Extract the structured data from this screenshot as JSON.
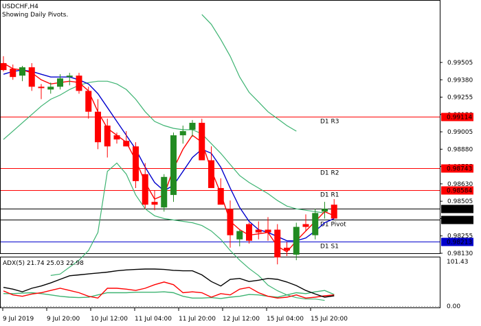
{
  "header": {
    "symbol": "USDCHF,H4",
    "subtitle": "Showing Daily Pivots."
  },
  "indicator": {
    "label": "ADX(5) 21.74 25.03 22.98",
    "top": "101.43",
    "bottom": "0.00"
  },
  "colors": {
    "bull": "#228b22",
    "bear": "#ff0000",
    "ma_fast": "#ff0000",
    "ma_slow": "#0000cd",
    "bands": "#3cb371",
    "adx": "#000000",
    "plus_di": "#ff0000",
    "minus_di": "#3cb371",
    "pivot_red": "#ff0000",
    "pivot_black": "#000000",
    "pivot_blue": "#0000cd"
  },
  "chart_data": {
    "type": "candlestick",
    "title": "USDCHF,H4",
    "ylim": [
      0.9813,
      0.9995
    ],
    "yticks": [
      "0.99505",
      "0.99380",
      "0.99255",
      "0.99130",
      "0.99005",
      "0.98880",
      "0.98755",
      "0.98630",
      "0.98505",
      "0.98380",
      "0.98255",
      "0.98130"
    ],
    "xticks": [
      "9 Jul 2019",
      "9 Jul 20:00",
      "10 Jul 12:00",
      "11 Jul 04:00",
      "11 Jul 20:00",
      "12 Jul 12:00",
      "15 Jul 04:00",
      "15 Jul 20:00"
    ],
    "candles": [
      [
        0.995,
        0.9955,
        0.9944,
        0.9945
      ],
      [
        0.9946,
        0.9949,
        0.9938,
        0.994
      ],
      [
        0.9941,
        0.9948,
        0.9937,
        0.9947
      ],
      [
        0.9947,
        0.995,
        0.993,
        0.9933
      ],
      [
        0.9933,
        0.9935,
        0.9924,
        0.9932
      ],
      [
        0.9931,
        0.9936,
        0.9928,
        0.9933
      ],
      [
        0.9933,
        0.9942,
        0.9931,
        0.9939
      ],
      [
        0.994,
        0.9943,
        0.9934,
        0.9941
      ],
      [
        0.9941,
        0.9943,
        0.9928,
        0.993
      ],
      [
        0.993,
        0.9933,
        0.991,
        0.9915
      ],
      [
        0.9915,
        0.9924,
        0.9888,
        0.9893
      ],
      [
        0.9905,
        0.991,
        0.9882,
        0.989
      ],
      [
        0.9898,
        0.99,
        0.9892,
        0.9895
      ],
      [
        0.9894,
        0.9901,
        0.989,
        0.989
      ],
      [
        0.989,
        0.9893,
        0.986,
        0.9865
      ],
      [
        0.987,
        0.9878,
        0.9845,
        0.9848
      ],
      [
        0.985,
        0.9858,
        0.9844,
        0.9848
      ],
      [
        0.9846,
        0.987,
        0.9843,
        0.9868
      ],
      [
        0.9855,
        0.99,
        0.985,
        0.9898
      ],
      [
        0.9898,
        0.9905,
        0.9892,
        0.9901
      ],
      [
        0.9902,
        0.9909,
        0.9897,
        0.9907
      ],
      [
        0.9907,
        0.991,
        0.9883,
        0.988
      ],
      [
        0.988,
        0.989,
        0.9868,
        0.986
      ],
      [
        0.986,
        0.9867,
        0.985,
        0.9848
      ],
      [
        0.9845,
        0.9851,
        0.9817,
        0.9826
      ],
      [
        0.9823,
        0.983,
        0.9818,
        0.9829
      ],
      [
        0.9834,
        0.9835,
        0.982,
        0.9822
      ],
      [
        0.983,
        0.9836,
        0.9823,
        0.9828
      ],
      [
        0.983,
        0.9839,
        0.9822,
        0.9828
      ],
      [
        0.983,
        0.9834,
        0.9805,
        0.981
      ],
      [
        0.9817,
        0.9821,
        0.9811,
        0.9815
      ],
      [
        0.9812,
        0.9835,
        0.9808,
        0.9832
      ],
      [
        0.9834,
        0.9841,
        0.9829,
        0.9832
      ],
      [
        0.9826,
        0.9845,
        0.9823,
        0.9842
      ],
      [
        0.9843,
        0.985,
        0.9838,
        0.9845
      ],
      [
        0.9848,
        0.9852,
        0.984,
        0.9838
      ]
    ],
    "ma_fast": [
      0.995,
      0.9946,
      0.9945,
      0.9943,
      0.9938,
      0.9935,
      0.9936,
      0.9937,
      0.9936,
      0.993,
      0.9915,
      0.9903,
      0.9898,
      0.9893,
      0.988,
      0.9864,
      0.9852,
      0.9855,
      0.9874,
      0.9888,
      0.9898,
      0.9893,
      0.9873,
      0.9856,
      0.9836,
      0.983,
      0.9826,
      0.9827,
      0.9828,
      0.9818,
      0.9814,
      0.9822,
      0.9829,
      0.9836,
      0.9843,
      0.984
    ],
    "ma_slow": [
      0.9942,
      0.9944,
      0.9945,
      0.9944,
      0.9942,
      0.994,
      0.994,
      0.994,
      0.9938,
      0.9935,
      0.9928,
      0.9918,
      0.9908,
      0.9898,
      0.9888,
      0.9875,
      0.9864,
      0.9858,
      0.9862,
      0.9872,
      0.9882,
      0.9888,
      0.9885,
      0.9875,
      0.986,
      0.9846,
      0.9836,
      0.983,
      0.9828,
      0.9825,
      0.9822,
      0.9822,
      0.9824,
      0.9829,
      0.9835,
      0.9838
    ],
    "upper_band": [
      null,
      null,
      null,
      null,
      null,
      null,
      null,
      null,
      null,
      null,
      null,
      null,
      null,
      null,
      null,
      null,
      null,
      null,
      null,
      null,
      null,
      0.9985,
      0.9978,
      0.9967,
      0.9955,
      0.994,
      0.9929,
      0.9922,
      0.9915,
      0.991,
      0.9905,
      0.9901,
      null,
      null,
      null,
      null
    ],
    "mid_band": [
      0.9895,
      0.9901,
      0.9907,
      0.9913,
      0.9919,
      0.9924,
      0.9927,
      0.9931,
      0.9934,
      0.9936,
      0.9937,
      0.9937,
      0.9935,
      0.9931,
      0.9924,
      0.9915,
      0.9908,
      0.9905,
      0.9903,
      0.9902,
      0.9902,
      0.9899,
      0.9892,
      0.9885,
      0.9877,
      0.9869,
      0.9864,
      0.986,
      0.9856,
      0.9851,
      0.9847,
      0.9845,
      0.9844,
      0.9843,
      0.9842,
      null
    ],
    "lower_band": [
      null,
      null,
      null,
      null,
      null,
      0.9797,
      0.9798,
      0.9803,
      0.9808,
      0.9815,
      0.9828,
      0.9872,
      0.9878,
      0.987,
      0.9855,
      0.9845,
      0.984,
      0.9838,
      0.9837,
      0.9836,
      0.9835,
      0.9833,
      0.9829,
      0.9823,
      0.9815,
      0.9808,
      0.9802,
      0.9797,
      0.979,
      0.9786,
      0.9783,
      0.9781,
      0.978,
      0.978,
      0.9779,
      null
    ],
    "pivots": [
      {
        "name": "D1 R3",
        "value": 0.99114,
        "label": "0.99114",
        "color": "#ff0000"
      },
      {
        "name": "D1 R2",
        "value": 0.98743,
        "label": "0.98743",
        "color": "#ff0000"
      },
      {
        "name": "D1 R1",
        "value": 0.98584,
        "label": "0.98584",
        "color": "#ff0000"
      },
      {
        "name": "",
        "value": 0.98451,
        "label": "0.98451",
        "color": "#000000"
      },
      {
        "name": "D1 Pivot",
        "value": 0.98372,
        "label": "0.98372",
        "color": "#000000"
      },
      {
        "name": "D1 S1",
        "value": 0.98213,
        "label": "0.98213",
        "color": "#0000cd"
      }
    ],
    "adx": {
      "ylim": [
        0,
        101.43
      ],
      "adx": [
        42,
        38,
        32,
        40,
        45,
        52,
        60,
        68,
        70,
        72,
        74,
        76,
        79,
        81,
        82,
        83,
        83,
        82,
        80,
        79,
        79,
        70,
        55,
        45,
        60,
        62,
        55,
        58,
        62,
        60,
        54,
        46,
        35,
        27,
        20,
        23
      ],
      "plus_di": [
        34,
        25,
        22,
        27,
        30,
        35,
        40,
        35,
        30,
        22,
        18,
        40,
        40,
        38,
        35,
        40,
        48,
        54,
        48,
        30,
        32,
        30,
        20,
        28,
        25,
        38,
        42,
        30,
        22,
        18,
        20,
        25,
        18,
        20,
        23,
        25
      ],
      "minus_di": [
        28,
        28,
        29,
        30,
        28,
        25,
        22,
        20,
        19,
        20,
        25,
        30,
        30,
        30,
        31,
        31,
        31,
        32,
        30,
        22,
        18,
        18,
        19,
        17,
        20,
        22,
        26,
        25,
        22,
        20,
        25,
        30,
        28,
        32,
        35,
        26
      ]
    }
  }
}
